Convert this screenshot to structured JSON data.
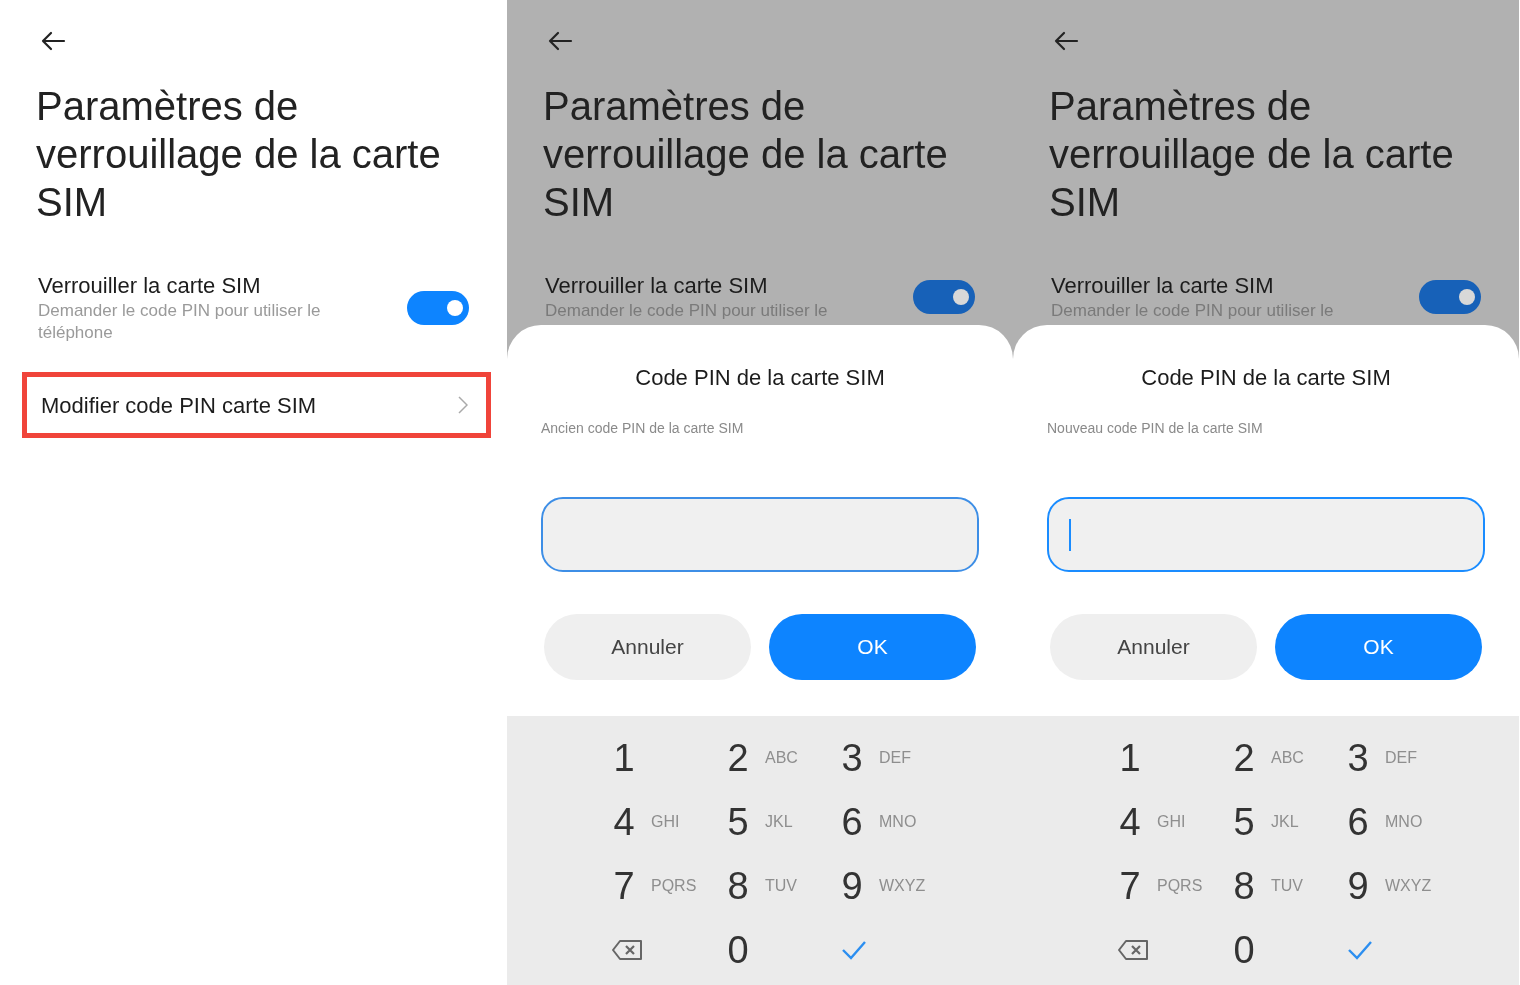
{
  "panels": [
    {
      "title": "Paramètres de verrouillage de la carte SIM",
      "dimmed": false,
      "setting": {
        "label": "Verrouiller la carte SIM",
        "description": "Demander le code PIN pour utiliser le téléphone",
        "on": true
      },
      "menu_item": {
        "label": "Modifier code PIN carte SIM",
        "highlighted": true
      }
    },
    {
      "title": "Paramètres de verrouillage de la carte SIM",
      "dimmed": true,
      "setting": {
        "label": "Verrouiller la carte SIM",
        "description": "Demander le code PIN pour utiliser le",
        "on": true
      },
      "dialog": {
        "title": "Code PIN de la carte SIM",
        "hint": "Ancien code PIN de la carte SIM",
        "focused": false,
        "buttons": [
          {
            "label": "Annuler",
            "kind": "secondary"
          },
          {
            "label": "OK",
            "kind": "primary"
          }
        ],
        "keypad": [
          {
            "kind": "digit",
            "digit": "1"
          },
          {
            "kind": "digit",
            "digit": "2",
            "letters": "ABC"
          },
          {
            "kind": "digit",
            "digit": "3",
            "letters": "DEF"
          },
          {
            "kind": "digit",
            "digit": "4",
            "letters": "GHI"
          },
          {
            "kind": "digit",
            "digit": "5",
            "letters": "JKL"
          },
          {
            "kind": "digit",
            "digit": "6",
            "letters": "MNO"
          },
          {
            "kind": "digit",
            "digit": "7",
            "letters": "PQRS"
          },
          {
            "kind": "digit",
            "digit": "8",
            "letters": "TUV"
          },
          {
            "kind": "digit",
            "digit": "9",
            "letters": "WXYZ"
          },
          {
            "kind": "backspace"
          },
          {
            "kind": "digit",
            "digit": "0"
          },
          {
            "kind": "done"
          }
        ]
      }
    },
    {
      "title": "Paramètres de verrouillage de la carte SIM",
      "dimmed": true,
      "setting": {
        "label": "Verrouiller la carte SIM",
        "description": "Demander le code PIN pour utiliser le",
        "on": true
      },
      "dialog": {
        "title": "Code PIN de la carte SIM",
        "hint": "Nouveau code PIN de la carte SIM",
        "focused": true,
        "buttons": [
          {
            "label": "Annuler",
            "kind": "secondary"
          },
          {
            "label": "OK",
            "kind": "primary"
          }
        ],
        "keypad": [
          {
            "kind": "digit",
            "digit": "1"
          },
          {
            "kind": "digit",
            "digit": "2",
            "letters": "ABC"
          },
          {
            "kind": "digit",
            "digit": "3",
            "letters": "DEF"
          },
          {
            "kind": "digit",
            "digit": "4",
            "letters": "GHI"
          },
          {
            "kind": "digit",
            "digit": "5",
            "letters": "JKL"
          },
          {
            "kind": "digit",
            "digit": "6",
            "letters": "MNO"
          },
          {
            "kind": "digit",
            "digit": "7",
            "letters": "PQRS"
          },
          {
            "kind": "digit",
            "digit": "8",
            "letters": "TUV"
          },
          {
            "kind": "digit",
            "digit": "9",
            "letters": "WXYZ"
          },
          {
            "kind": "backspace"
          },
          {
            "kind": "digit",
            "digit": "0"
          },
          {
            "kind": "done"
          }
        ]
      }
    }
  ]
}
